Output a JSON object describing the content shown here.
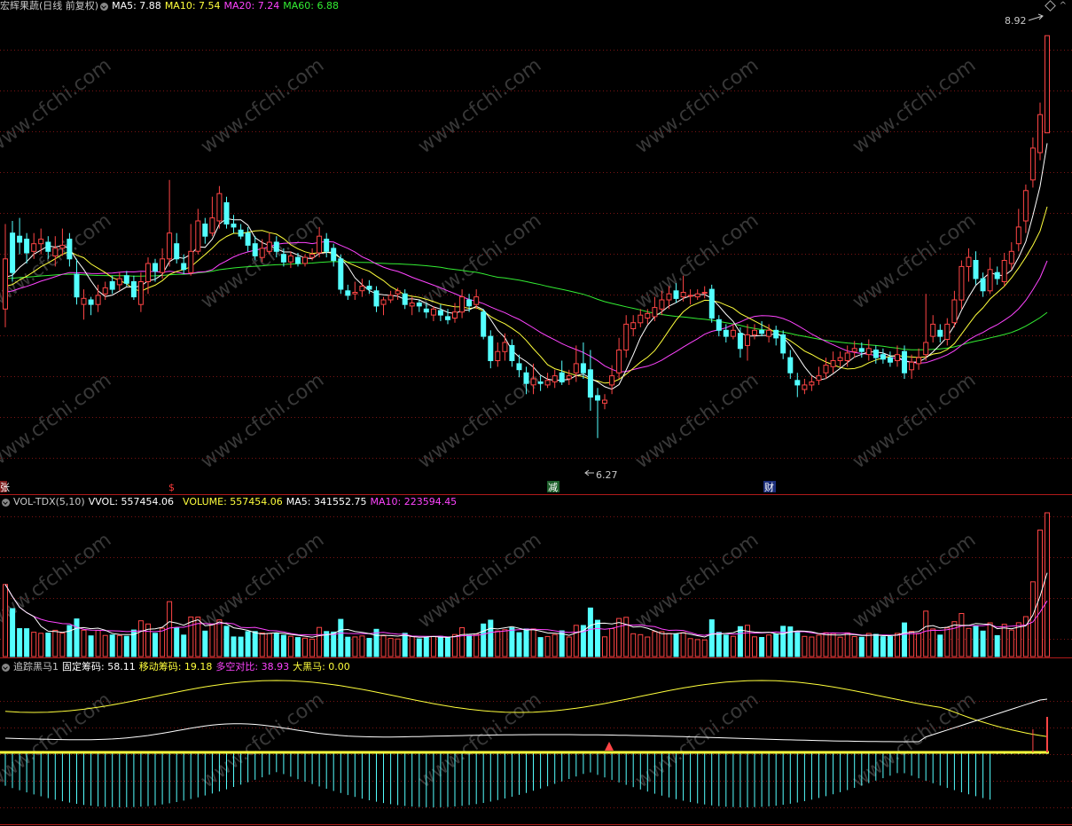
{
  "colors": {
    "up": "#ff4545",
    "down": "#54ffff",
    "ma5": "#ffffff",
    "ma10": "#ffff3c",
    "ma20": "#ff44ff",
    "ma60": "#33ee33",
    "grid": "#7a1414",
    "sep": "#b01a1a",
    "text": "#c8c8c8",
    "watermark": "#383838"
  },
  "header_main": {
    "stock_name": "宏辉果蔬(日线 前复权)",
    "ma5": "MA5: 7.88",
    "ma10": "MA10: 7.54",
    "ma20": "MA20: 7.24",
    "ma60": "MA60: 6.88"
  },
  "header_vol": {
    "name": "VOL-TDX(5,10)",
    "vvol": "VVOL: 557454.06",
    "volume": "VOLUME: 557454.06",
    "ma5": "MA5: 341552.75",
    "ma10": "MA10: 223594.45"
  },
  "header_ind": {
    "name": "追踪黑马1",
    "fixed": "固定筹码: 58.11",
    "moving": "移动筹码: 19.18",
    "ratio": "多空对比: 38.93",
    "horse": "大黑马: 0.00"
  },
  "annotations": {
    "high": "8.92",
    "low": "6.27",
    "events": [
      "张",
      "$",
      "减",
      "财"
    ]
  },
  "watermark": "www.cfchi.com",
  "icons": [
    "circle-menu-icon",
    "diamond-icon",
    "expand-icon"
  ],
  "chart_data": {
    "type": "candlestick",
    "title": "宏辉果蔬(日线 前复权)",
    "ylim": [
      6.0,
      9.05
    ],
    "price_extremes": {
      "high": 8.92,
      "low": 6.27
    },
    "candles": [
      {
        "o": 7.12,
        "c": 7.45,
        "h": 7.68,
        "l": 7.0
      },
      {
        "o": 7.62,
        "c": 7.36,
        "h": 7.7,
        "l": 7.3
      },
      {
        "o": 7.6,
        "c": 7.56,
        "h": 7.72,
        "l": 7.48
      },
      {
        "o": 7.58,
        "c": 7.49,
        "h": 7.62,
        "l": 7.42
      },
      {
        "o": 7.5,
        "c": 7.55,
        "h": 7.62,
        "l": 7.45
      },
      {
        "o": 7.55,
        "c": 7.58,
        "h": 7.65,
        "l": 7.48
      },
      {
        "o": 7.56,
        "c": 7.5,
        "h": 7.6,
        "l": 7.45
      },
      {
        "o": 7.47,
        "c": 7.52,
        "h": 7.6,
        "l": 7.4
      },
      {
        "o": 7.52,
        "c": 7.54,
        "h": 7.65,
        "l": 7.47
      },
      {
        "o": 7.58,
        "c": 7.45,
        "h": 7.62,
        "l": 7.4
      },
      {
        "o": 7.35,
        "c": 7.2,
        "h": 7.45,
        "l": 7.15
      },
      {
        "o": 7.15,
        "c": 7.19,
        "h": 7.25,
        "l": 7.05
      },
      {
        "o": 7.18,
        "c": 7.15,
        "h": 7.2,
        "l": 7.08
      },
      {
        "o": 7.15,
        "c": 7.21,
        "h": 7.28,
        "l": 7.1
      },
      {
        "o": 7.22,
        "c": 7.26,
        "h": 7.3,
        "l": 7.18
      },
      {
        "o": 7.3,
        "c": 7.25,
        "h": 7.34,
        "l": 7.22
      },
      {
        "o": 7.28,
        "c": 7.32,
        "h": 7.36,
        "l": 7.24
      },
      {
        "o": 7.34,
        "c": 7.29,
        "h": 7.37,
        "l": 7.27
      },
      {
        "o": 7.3,
        "c": 7.2,
        "h": 7.34,
        "l": 7.18
      },
      {
        "o": 7.15,
        "c": 7.3,
        "h": 7.36,
        "l": 7.1
      },
      {
        "o": 7.3,
        "c": 7.42,
        "h": 7.46,
        "l": 7.22
      },
      {
        "o": 7.42,
        "c": 7.37,
        "h": 7.45,
        "l": 7.3
      },
      {
        "o": 7.36,
        "c": 7.45,
        "h": 7.52,
        "l": 7.32
      },
      {
        "o": 7.45,
        "c": 7.62,
        "h": 7.97,
        "l": 7.4
      },
      {
        "o": 7.55,
        "c": 7.45,
        "h": 7.62,
        "l": 7.42
      },
      {
        "o": 7.42,
        "c": 7.38,
        "h": 7.48,
        "l": 7.35
      },
      {
        "o": 7.36,
        "c": 7.5,
        "h": 7.68,
        "l": 7.34
      },
      {
        "o": 7.5,
        "c": 7.7,
        "h": 7.78,
        "l": 7.48
      },
      {
        "o": 7.68,
        "c": 7.6,
        "h": 7.72,
        "l": 7.55
      },
      {
        "o": 7.62,
        "c": 7.72,
        "h": 7.86,
        "l": 7.6
      },
      {
        "o": 7.7,
        "c": 7.88,
        "h": 7.93,
        "l": 7.65
      },
      {
        "o": 7.82,
        "c": 7.68,
        "h": 7.86,
        "l": 7.65
      },
      {
        "o": 7.68,
        "c": 7.66,
        "h": 7.74,
        "l": 7.62
      },
      {
        "o": 7.64,
        "c": 7.6,
        "h": 7.68,
        "l": 7.58
      },
      {
        "o": 7.62,
        "c": 7.54,
        "h": 7.66,
        "l": 7.5
      },
      {
        "o": 7.55,
        "c": 7.47,
        "h": 7.6,
        "l": 7.44
      },
      {
        "o": 7.46,
        "c": 7.52,
        "h": 7.58,
        "l": 7.43
      },
      {
        "o": 7.5,
        "c": 7.56,
        "h": 7.62,
        "l": 7.48
      },
      {
        "o": 7.56,
        "c": 7.5,
        "h": 7.6,
        "l": 7.46
      },
      {
        "o": 7.48,
        "c": 7.43,
        "h": 7.52,
        "l": 7.4
      },
      {
        "o": 7.43,
        "c": 7.47,
        "h": 7.5,
        "l": 7.39
      },
      {
        "o": 7.46,
        "c": 7.42,
        "h": 7.49,
        "l": 7.4
      },
      {
        "o": 7.42,
        "c": 7.46,
        "h": 7.48,
        "l": 7.4
      },
      {
        "o": 7.46,
        "c": 7.48,
        "h": 7.52,
        "l": 7.44
      },
      {
        "o": 7.49,
        "c": 7.6,
        "h": 7.66,
        "l": 7.46
      },
      {
        "o": 7.58,
        "c": 7.5,
        "h": 7.62,
        "l": 7.46
      },
      {
        "o": 7.52,
        "c": 7.44,
        "h": 7.55,
        "l": 7.4
      },
      {
        "o": 7.45,
        "c": 7.25,
        "h": 7.48,
        "l": 7.22
      },
      {
        "o": 7.24,
        "c": 7.21,
        "h": 7.28,
        "l": 7.18
      },
      {
        "o": 7.22,
        "c": 7.23,
        "h": 7.3,
        "l": 7.18
      },
      {
        "o": 7.24,
        "c": 7.27,
        "h": 7.32,
        "l": 7.2
      },
      {
        "o": 7.27,
        "c": 7.25,
        "h": 7.31,
        "l": 7.22
      },
      {
        "o": 7.24,
        "c": 7.14,
        "h": 7.27,
        "l": 7.1
      },
      {
        "o": 7.15,
        "c": 7.18,
        "h": 7.2,
        "l": 7.08
      },
      {
        "o": 7.18,
        "c": 7.21,
        "h": 7.24,
        "l": 7.16
      },
      {
        "o": 7.22,
        "c": 7.24,
        "h": 7.26,
        "l": 7.18
      },
      {
        "o": 7.22,
        "c": 7.15,
        "h": 7.25,
        "l": 7.12
      },
      {
        "o": 7.14,
        "c": 7.16,
        "h": 7.2,
        "l": 7.08
      },
      {
        "o": 7.16,
        "c": 7.14,
        "h": 7.18,
        "l": 7.1
      },
      {
        "o": 7.12,
        "c": 7.1,
        "h": 7.16,
        "l": 7.06
      },
      {
        "o": 7.08,
        "c": 7.12,
        "h": 7.14,
        "l": 7.04
      },
      {
        "o": 7.11,
        "c": 7.08,
        "h": 7.15,
        "l": 7.04
      },
      {
        "o": 7.07,
        "c": 7.05,
        "h": 7.12,
        "l": 7.02
      },
      {
        "o": 7.06,
        "c": 7.1,
        "h": 7.16,
        "l": 7.03
      },
      {
        "o": 7.1,
        "c": 7.2,
        "h": 7.25,
        "l": 7.06
      },
      {
        "o": 7.18,
        "c": 7.14,
        "h": 7.22,
        "l": 7.1
      },
      {
        "o": 7.15,
        "c": 7.2,
        "h": 7.25,
        "l": 7.12
      },
      {
        "o": 7.1,
        "c": 6.94,
        "h": 7.12,
        "l": 6.92
      },
      {
        "o": 6.94,
        "c": 6.78,
        "h": 6.98,
        "l": 6.73
      },
      {
        "o": 6.78,
        "c": 6.84,
        "h": 6.9,
        "l": 6.74
      },
      {
        "o": 6.84,
        "c": 6.9,
        "h": 6.96,
        "l": 6.78
      },
      {
        "o": 6.88,
        "c": 6.78,
        "h": 6.92,
        "l": 6.74
      },
      {
        "o": 6.76,
        "c": 6.72,
        "h": 6.82,
        "l": 6.67
      },
      {
        "o": 6.7,
        "c": 6.63,
        "h": 6.74,
        "l": 6.56
      },
      {
        "o": 6.62,
        "c": 6.66,
        "h": 6.76,
        "l": 6.56
      },
      {
        "o": 6.64,
        "c": 6.63,
        "h": 6.68,
        "l": 6.58
      },
      {
        "o": 6.62,
        "c": 6.65,
        "h": 6.7,
        "l": 6.6
      },
      {
        "o": 6.64,
        "c": 6.68,
        "h": 6.72,
        "l": 6.6
      },
      {
        "o": 6.7,
        "c": 6.64,
        "h": 6.78,
        "l": 6.62
      },
      {
        "o": 6.66,
        "c": 6.68,
        "h": 6.72,
        "l": 6.62
      },
      {
        "o": 6.7,
        "c": 6.76,
        "h": 6.88,
        "l": 6.64
      },
      {
        "o": 6.76,
        "c": 6.7,
        "h": 6.9,
        "l": 6.66
      },
      {
        "o": 6.72,
        "c": 6.54,
        "h": 6.85,
        "l": 6.45
      },
      {
        "o": 6.55,
        "c": 6.52,
        "h": 6.6,
        "l": 6.27
      },
      {
        "o": 6.5,
        "c": 6.52,
        "h": 6.56,
        "l": 6.46
      },
      {
        "o": 6.62,
        "c": 6.68,
        "h": 6.75,
        "l": 6.56
      },
      {
        "o": 6.7,
        "c": 6.85,
        "h": 6.93,
        "l": 6.66
      },
      {
        "o": 6.85,
        "c": 7.02,
        "h": 7.08,
        "l": 6.8
      },
      {
        "o": 6.99,
        "c": 7.03,
        "h": 7.08,
        "l": 6.94
      },
      {
        "o": 7.03,
        "c": 7.08,
        "h": 7.12,
        "l": 7.0
      },
      {
        "o": 7.06,
        "c": 7.09,
        "h": 7.12,
        "l": 7.02
      },
      {
        "o": 7.07,
        "c": 7.13,
        "h": 7.2,
        "l": 7.04
      },
      {
        "o": 7.12,
        "c": 7.18,
        "h": 7.24,
        "l": 7.08
      },
      {
        "o": 7.18,
        "c": 7.22,
        "h": 7.27,
        "l": 7.12
      },
      {
        "o": 7.24,
        "c": 7.19,
        "h": 7.29,
        "l": 7.16
      },
      {
        "o": 7.2,
        "c": 7.23,
        "h": 7.34,
        "l": 7.17
      },
      {
        "o": 7.21,
        "c": 7.21,
        "h": 7.25,
        "l": 7.15
      },
      {
        "o": 7.2,
        "c": 7.22,
        "h": 7.25,
        "l": 7.18
      },
      {
        "o": 7.23,
        "c": 7.23,
        "h": 7.27,
        "l": 7.19
      },
      {
        "o": 7.25,
        "c": 7.06,
        "h": 7.28,
        "l": 7.03
      },
      {
        "o": 7.05,
        "c": 6.98,
        "h": 7.08,
        "l": 6.94
      },
      {
        "o": 6.98,
        "c": 6.94,
        "h": 7.02,
        "l": 6.9
      },
      {
        "o": 6.94,
        "c": 6.98,
        "h": 7.02,
        "l": 6.92
      },
      {
        "o": 6.96,
        "c": 6.86,
        "h": 7.0,
        "l": 6.8
      },
      {
        "o": 6.88,
        "c": 6.95,
        "h": 7.02,
        "l": 6.78
      },
      {
        "o": 6.95,
        "c": 6.98,
        "h": 7.02,
        "l": 6.92
      },
      {
        "o": 6.98,
        "c": 6.96,
        "h": 7.04,
        "l": 6.94
      },
      {
        "o": 6.94,
        "c": 6.98,
        "h": 7.02,
        "l": 6.9
      },
      {
        "o": 6.98,
        "c": 6.93,
        "h": 7.01,
        "l": 6.88
      },
      {
        "o": 6.95,
        "c": 6.83,
        "h": 6.98,
        "l": 6.79
      },
      {
        "o": 6.8,
        "c": 6.7,
        "h": 6.85,
        "l": 6.66
      },
      {
        "o": 6.65,
        "c": 6.62,
        "h": 6.7,
        "l": 6.54
      },
      {
        "o": 6.59,
        "c": 6.62,
        "h": 6.66,
        "l": 6.56
      },
      {
        "o": 6.62,
        "c": 6.64,
        "h": 6.68,
        "l": 6.58
      },
      {
        "o": 6.65,
        "c": 6.68,
        "h": 6.74,
        "l": 6.62
      },
      {
        "o": 6.7,
        "c": 6.75,
        "h": 6.8,
        "l": 6.66
      },
      {
        "o": 6.74,
        "c": 6.78,
        "h": 6.84,
        "l": 6.7
      },
      {
        "o": 6.78,
        "c": 6.8,
        "h": 6.84,
        "l": 6.74
      },
      {
        "o": 6.78,
        "c": 6.83,
        "h": 6.88,
        "l": 6.74
      },
      {
        "o": 6.84,
        "c": 6.86,
        "h": 6.91,
        "l": 6.8
      },
      {
        "o": 6.86,
        "c": 6.84,
        "h": 6.9,
        "l": 6.8
      },
      {
        "o": 6.82,
        "c": 6.86,
        "h": 6.92,
        "l": 6.78
      },
      {
        "o": 6.85,
        "c": 6.8,
        "h": 6.88,
        "l": 6.76
      },
      {
        "o": 6.82,
        "c": 6.79,
        "h": 6.86,
        "l": 6.76
      },
      {
        "o": 6.8,
        "c": 6.77,
        "h": 6.84,
        "l": 6.74
      },
      {
        "o": 6.78,
        "c": 6.82,
        "h": 6.88,
        "l": 6.74
      },
      {
        "o": 6.84,
        "c": 6.7,
        "h": 6.88,
        "l": 6.66
      },
      {
        "o": 6.72,
        "c": 6.77,
        "h": 6.82,
        "l": 6.66
      },
      {
        "o": 6.76,
        "c": 6.8,
        "h": 6.86,
        "l": 6.72
      },
      {
        "o": 6.82,
        "c": 6.9,
        "h": 7.22,
        "l": 6.78
      },
      {
        "o": 6.94,
        "c": 7.02,
        "h": 7.08,
        "l": 6.9
      },
      {
        "o": 6.98,
        "c": 6.94,
        "h": 7.02,
        "l": 6.9
      },
      {
        "o": 6.92,
        "c": 7.02,
        "h": 7.06,
        "l": 6.88
      },
      {
        "o": 7.03,
        "c": 7.18,
        "h": 7.24,
        "l": 7.0
      },
      {
        "o": 7.18,
        "c": 7.4,
        "h": 7.44,
        "l": 7.12
      },
      {
        "o": 7.4,
        "c": 7.46,
        "h": 7.52,
        "l": 7.3
      },
      {
        "o": 7.44,
        "c": 7.32,
        "h": 7.5,
        "l": 7.28
      },
      {
        "o": 7.32,
        "c": 7.24,
        "h": 7.36,
        "l": 7.2
      },
      {
        "o": 7.24,
        "c": 7.38,
        "h": 7.46,
        "l": 7.22
      },
      {
        "o": 7.36,
        "c": 7.32,
        "h": 7.4,
        "l": 7.28
      },
      {
        "o": 7.3,
        "c": 7.44,
        "h": 7.49,
        "l": 7.27
      },
      {
        "o": 7.42,
        "c": 7.5,
        "h": 7.56,
        "l": 7.38
      },
      {
        "o": 7.55,
        "c": 7.66,
        "h": 7.78,
        "l": 7.5
      },
      {
        "o": 7.7,
        "c": 7.9,
        "h": 7.94,
        "l": 7.62
      },
      {
        "o": 7.97,
        "c": 8.18,
        "h": 8.25,
        "l": 7.92
      },
      {
        "o": 8.15,
        "c": 8.4,
        "h": 8.48,
        "l": 8.1
      },
      {
        "o": 8.28,
        "c": 8.92,
        "h": 8.92,
        "l": 8.28
      }
    ]
  }
}
